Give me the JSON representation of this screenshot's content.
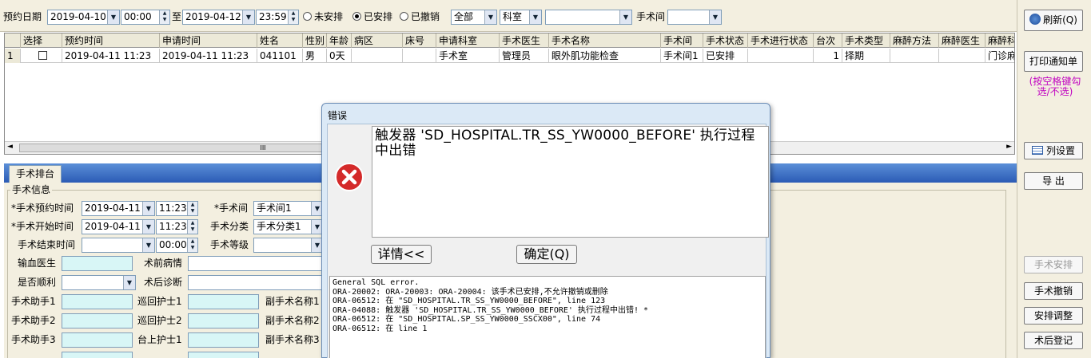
{
  "filter": {
    "date_label": "预约日期",
    "date_from": "2019-04-10",
    "time_from": "00:00",
    "to_label": "至",
    "date_to": "2019-04-12",
    "time_to": "23:59",
    "radio_unscheduled": "未安排",
    "radio_scheduled": "已安排",
    "radio_cancelled": "已撤销",
    "select_all": "全部",
    "select_dept": "科室",
    "select_blank": "",
    "room_label": "手术间",
    "room_value": ""
  },
  "table": {
    "columns": [
      "选择",
      "预约时间",
      "申请时间",
      "姓名",
      "性别",
      "年龄",
      "病区",
      "床号",
      "申请科室",
      "手术医生",
      "手术名称",
      "手术间",
      "手术状态",
      "手术进行状态",
      "台次",
      "手术类型",
      "麻醉方法",
      "麻醉医生",
      "麻醉科室"
    ],
    "rows": [
      {
        "index": "1",
        "appt_time": "2019-04-11 11:23",
        "apply_time": "2019-04-11 11:23",
        "name": "041101",
        "gender": "男",
        "age": "0天",
        "ward": "",
        "bed": "",
        "apply_dept": "手术室",
        "surgeon": "管理员",
        "surgery_name": "眼外肌功能检查",
        "room": "手术间1",
        "status": "已安排",
        "progress": "",
        "seq": "1",
        "surgery_type": "择期",
        "anesthesia_method": "",
        "anesthetist": "",
        "anesthesia_dept": "门诊麻醉"
      }
    ],
    "scroll_grip": "III"
  },
  "tabs": {
    "schedule": "手术排台"
  },
  "form": {
    "group_title": "手术信息",
    "appt_time_label": "*手术预约时间",
    "appt_date": "2019-04-11",
    "appt_time": "11:23",
    "room_label": "*手术间",
    "room_value": "手术间1",
    "start_time_label": "*手术开始时间",
    "start_date": "2019-04-11",
    "start_time": "11:23",
    "category_label": "手术分类",
    "category_value": "手术分类1",
    "end_time_label": "手术结束时间",
    "end_time": "00:00",
    "level_label": "手术等级",
    "transfusion_label": "输血医生",
    "pre_label": "术前病情",
    "smooth_label": "是否顺利",
    "post_label": "术后诊断",
    "assistant1_label": "手术助手1",
    "circ_nurse1_label": "巡回护士1",
    "sub_name1_label": "副手术名称1",
    "assistant2_label": "手术助手2",
    "circ_nurse2_label": "巡回护士2",
    "sub_name2_label": "副手术名称2",
    "assistant3_label": "手术助手3",
    "scrub_nurse1_label": "台上护士1",
    "sub_name3_label": "副手术名称3"
  },
  "sidebar": {
    "refresh": "刷新(Q)",
    "print_notice": "打印通知单",
    "hint": "(按空格键勾选/不选)",
    "column_settings": "列设置",
    "export": "导  出",
    "arrange": "手术安排",
    "cancel": "手术撤销",
    "adjust": "安排调整",
    "post_register": "术后登记"
  },
  "dialog": {
    "title": "错误",
    "message": " 触发器 'SD_HOSPITAL.TR_SS_YW0000_BEFORE' 执行过程中出错",
    "details_button": "详情<<",
    "ok_button": "确定(Q)",
    "detail_lines": [
      "General SQL error.",
      "ORA-20002: ORA-20003: ORA-20004: 该手术已安排,不允许撤销或删除",
      "ORA-06512: 在 \"SD_HOSPITAL.TR_SS_YW0000_BEFORE\", line 123",
      "ORA-04088: 触发器 'SD_HOSPITAL.TR_SS_YW0000_BEFORE' 执行过程中出错! *",
      "ORA-06512: 在 \"SD_HOSPITAL.SP_SS_YW0000_SSCX00\", line 74",
      "ORA-06512: 在 line 1"
    ]
  },
  "colors": {
    "accent": "#2b5bb5",
    "panel": "#f3efe0",
    "hint": "#c000c0",
    "field_cyan": "#d8f6f6",
    "error": "#d42a2a"
  }
}
